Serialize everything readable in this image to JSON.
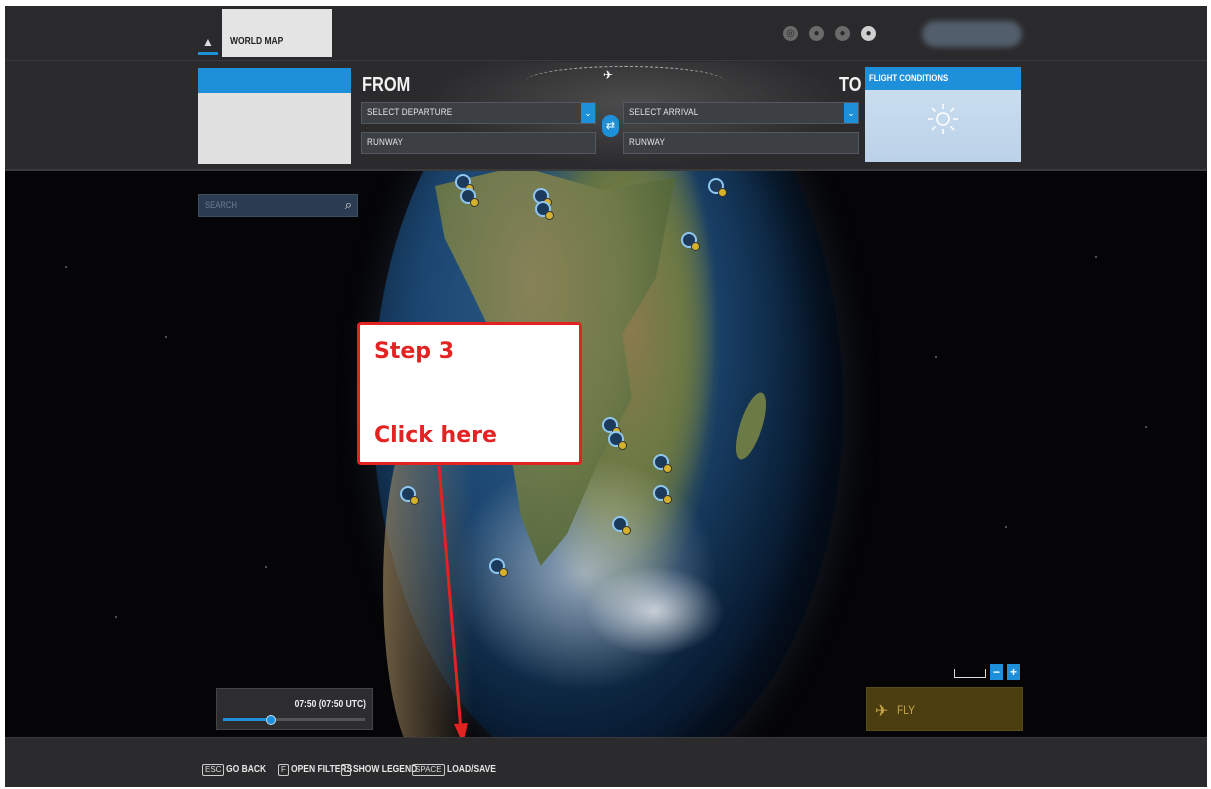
{
  "top_nav": {
    "home_icon": "home-icon",
    "tab_world_map": "WORLD MAP",
    "icons": [
      "community-icon",
      "multiplayer-icon",
      "profile-icon",
      "notifications-icon"
    ]
  },
  "flight": {
    "from_label": "FROM",
    "to_label": "TO",
    "departure_placeholder": "SELECT DEPARTURE",
    "arrival_placeholder": "SELECT ARRIVAL",
    "departure_runway": "RUNWAY",
    "arrival_runway": "RUNWAY",
    "swap_icon": "swap-icon",
    "dropdown_icon": "chevron-down-icon"
  },
  "conditions": {
    "title": "FLIGHT CONDITIONS",
    "weather_icon": "sun-icon"
  },
  "search": {
    "placeholder": "SEARCH",
    "icon": "search-icon"
  },
  "annotation": {
    "step": "Step 3",
    "instruction": "Click here",
    "color": "#e32222"
  },
  "time": {
    "label": "07:50 (07:50 UTC)",
    "fraction": 0.33
  },
  "zoom": {
    "minus": "−",
    "plus": "+"
  },
  "fly": {
    "label": "FLY",
    "icon": "takeoff-icon"
  },
  "bottom_hints": [
    {
      "key": "ESC",
      "label": "GO BACK"
    },
    {
      "key": "F",
      "label": "OPEN FILTERS"
    },
    {
      "key": "L",
      "label": "SHOW LEGEND"
    },
    {
      "key": "SPACE",
      "label": "LOAD/SAVE"
    }
  ],
  "colors": {
    "accent": "#1e8fd9",
    "fly": "#4a3d10",
    "background": "#050507"
  }
}
